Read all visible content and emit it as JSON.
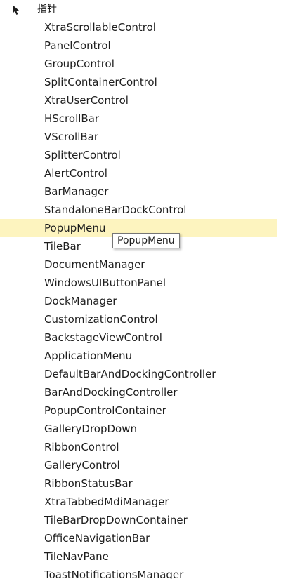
{
  "pointer": {
    "icon": "pointer-arrow-icon",
    "label": "指针"
  },
  "items": [
    {
      "label": "XtraScrollableControl"
    },
    {
      "label": "PanelControl"
    },
    {
      "label": "GroupControl"
    },
    {
      "label": "SplitContainerControl"
    },
    {
      "label": "XtraUserControl"
    },
    {
      "label": "HScrollBar"
    },
    {
      "label": "VScrollBar"
    },
    {
      "label": "SplitterControl"
    },
    {
      "label": "AlertControl"
    },
    {
      "label": "BarManager"
    },
    {
      "label": "StandaloneBarDockControl"
    },
    {
      "label": "PopupMenu",
      "selected": true
    },
    {
      "label": "TileBar"
    },
    {
      "label": "DocumentManager"
    },
    {
      "label": "WindowsUIButtonPanel"
    },
    {
      "label": "DockManager"
    },
    {
      "label": "CustomizationControl"
    },
    {
      "label": "BackstageViewControl"
    },
    {
      "label": "ApplicationMenu"
    },
    {
      "label": "DefaultBarAndDockingController"
    },
    {
      "label": "BarAndDockingController"
    },
    {
      "label": "PopupControlContainer"
    },
    {
      "label": "GalleryDropDown"
    },
    {
      "label": "RibbonControl"
    },
    {
      "label": "GalleryControl"
    },
    {
      "label": "RibbonStatusBar"
    },
    {
      "label": "XtraTabbedMdiManager"
    },
    {
      "label": "TileBarDropDownContainer"
    },
    {
      "label": "OfficeNavigationBar"
    },
    {
      "label": "TileNavPane"
    },
    {
      "label": "ToastNotificationsManager"
    }
  ],
  "tooltip": {
    "text": "PopupMenu"
  },
  "colors": {
    "selected_background": "#fdf4bf",
    "text": "#1e1e1e",
    "tooltip_border": "#767676"
  }
}
